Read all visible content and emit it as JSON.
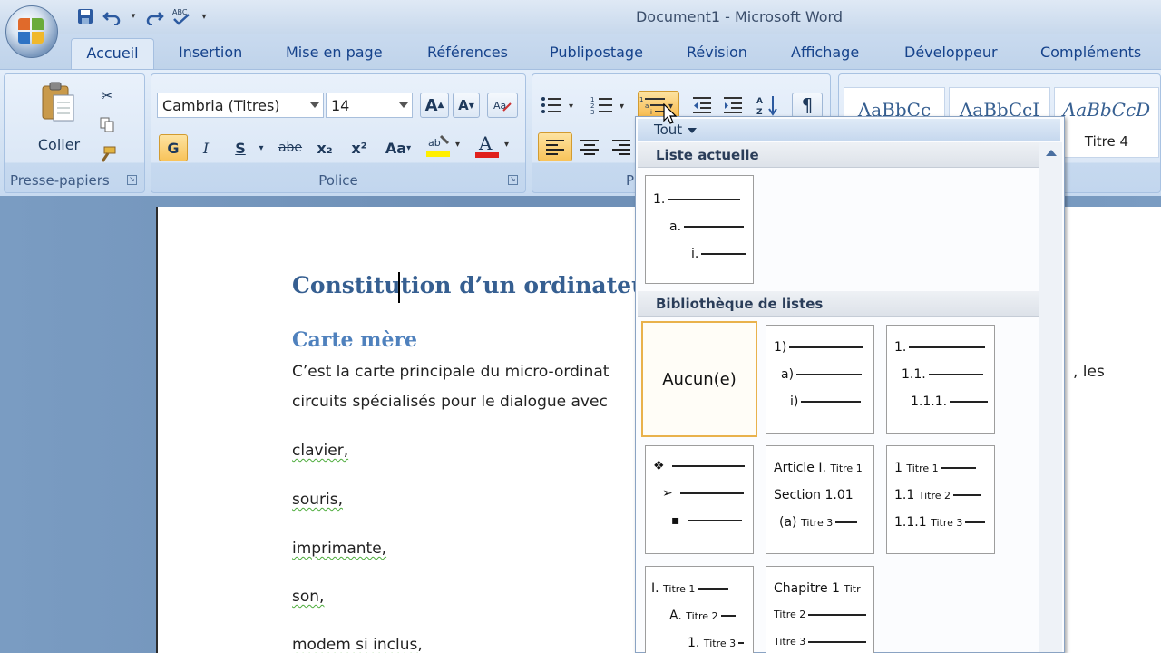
{
  "window": {
    "title": "Document1 - Microsoft Word"
  },
  "tabs": [
    "Accueil",
    "Insertion",
    "Mise en page",
    "Références",
    "Publipostage",
    "Révision",
    "Affichage",
    "Développeur",
    "Compléments"
  ],
  "clipboard": {
    "paste_label": "Coller",
    "group_label": "Presse-papiers"
  },
  "font": {
    "family": "Cambria (Titres)",
    "size": "14",
    "group_label": "Police",
    "bold_label": "G",
    "italic_label": "I",
    "underline_label": "S",
    "strike_label": "abe",
    "subscript_label": "x₂",
    "superscript_label": "x²",
    "case_label": "Aa",
    "grow_label": "A",
    "shrink_label": "A"
  },
  "paragraph": {
    "group_label": "P",
    "pilcrow": "¶"
  },
  "styles": [
    {
      "sample": "AaBbCc",
      "name": ""
    },
    {
      "sample": "AaBbCcI",
      "name": ""
    },
    {
      "sample": "AaBbCcD",
      "name": "Titre 4"
    }
  ],
  "document": {
    "heading1": "Constitution d’un ordinateu",
    "heading2": "Carte mère",
    "para1_a": "C’est la carte principale du micro-ordinat",
    "para1_b": ", les",
    "para2": "circuits spécialisés pour le dialogue avec",
    "items": [
      "clavier,",
      "souris,",
      "imprimante,",
      "son,",
      "modem si inclus,"
    ]
  },
  "dropdown": {
    "filter_label": "Tout",
    "section_current": "Liste actuelle",
    "section_library": "Bibliothèque de listes",
    "current_list": [
      "1.",
      "a.",
      "i."
    ],
    "none_label": "Aucun(e)",
    "list_paren": [
      "1)",
      "a)",
      "i)"
    ],
    "list_decimal": [
      "1.",
      "1.1.",
      "1.1.1."
    ],
    "list_bullets": [
      "❖",
      "➢",
      "▪"
    ],
    "list_article": [
      "Article I.",
      "Titre 1",
      "Section 1.01",
      "(a)",
      "Titre 3"
    ],
    "list_titre_num": [
      "1",
      "Titre 1",
      "1.1",
      "Titre 2",
      "1.1.1",
      "Titre 3"
    ],
    "list_roman": [
      "I.",
      "Titre 1",
      "A.",
      "Titre 2",
      "1.",
      "Titre 3"
    ],
    "list_chapitre": [
      "Chapitre 1",
      "Titr",
      "Titre 2",
      "Titre 3"
    ]
  }
}
